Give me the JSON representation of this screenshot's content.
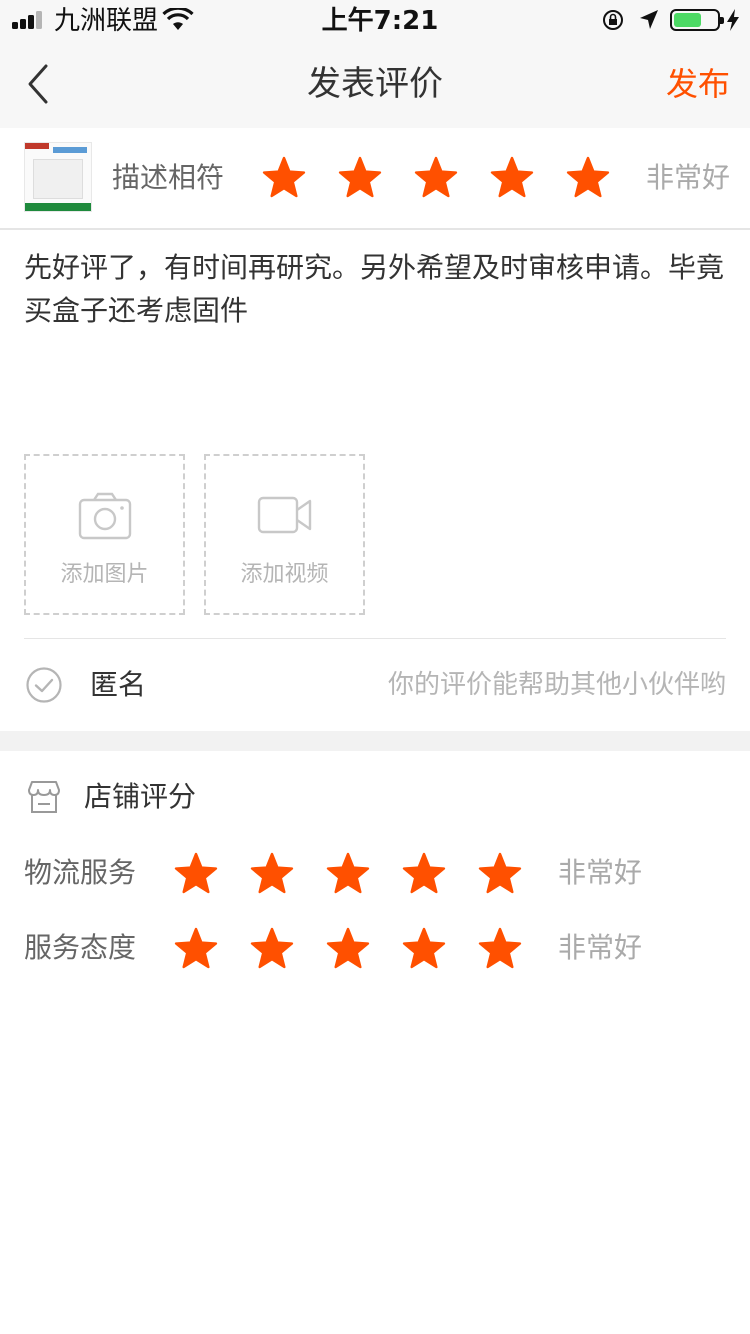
{
  "status_bar": {
    "carrier": "九洲联盟",
    "time": "上午7:21",
    "battery_level": 0.58
  },
  "nav": {
    "title": "发表评价",
    "publish_label": "发布",
    "accent_color": "#ff5000"
  },
  "product_rating": {
    "label": "描述相符",
    "stars": 5,
    "rating_text": "非常好"
  },
  "review": {
    "text": "先好评了，有时间再研究。另外希望及时审核申请。毕竟买盒子还考虑固件"
  },
  "media": {
    "add_photo_label": "添加图片",
    "add_video_label": "添加视频"
  },
  "anonymous": {
    "label": "匿名",
    "hint": "你的评价能帮助其他小伙伴哟"
  },
  "shop_rating": {
    "title": "店铺评分",
    "items": [
      {
        "label": "物流服务",
        "stars": 5,
        "rating_text": "非常好"
      },
      {
        "label": "服务态度",
        "stars": 5,
        "rating_text": "非常好"
      }
    ]
  },
  "colors": {
    "star": "#ff5000",
    "secondary_text": "#aaaaaa"
  }
}
